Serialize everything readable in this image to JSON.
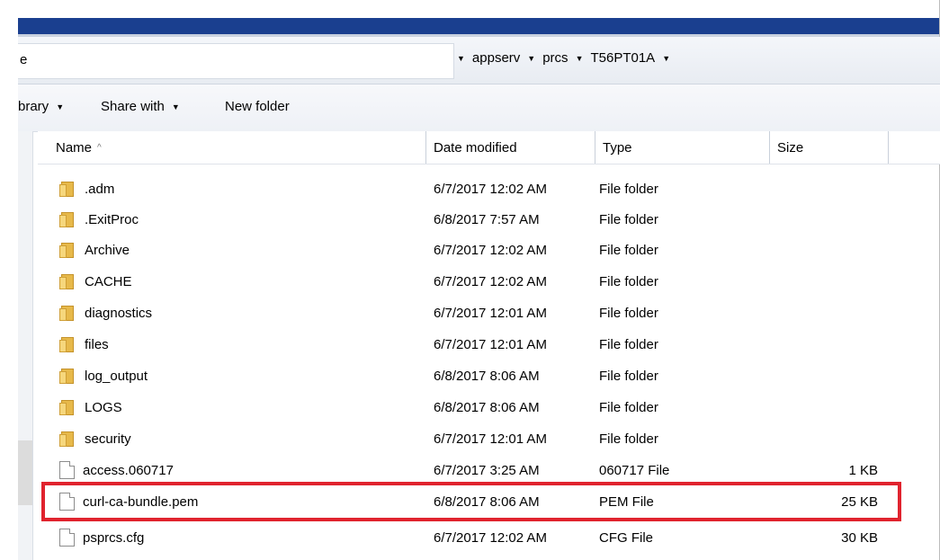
{
  "address": {
    "left_fragment": "e",
    "crumbs": [
      "appserv",
      "prcs",
      "T56PT01A"
    ]
  },
  "toolbar": {
    "library_label": "brary",
    "share_label": "Share with",
    "new_folder_label": "New folder"
  },
  "columns": {
    "name": "Name",
    "date": "Date modified",
    "type": "Type",
    "size": "Size"
  },
  "files": [
    {
      "name": ".adm",
      "date": "6/7/2017 12:02 AM",
      "type": "File folder",
      "size": "",
      "icon": "folder-icon"
    },
    {
      "name": ".ExitProc",
      "date": "6/8/2017 7:57 AM",
      "type": "File folder",
      "size": "",
      "icon": "folder-icon"
    },
    {
      "name": "Archive",
      "date": "6/7/2017 12:02 AM",
      "type": "File folder",
      "size": "",
      "icon": "folder-icon"
    },
    {
      "name": "CACHE",
      "date": "6/7/2017 12:02 AM",
      "type": "File folder",
      "size": "",
      "icon": "folder-icon"
    },
    {
      "name": "diagnostics",
      "date": "6/7/2017 12:01 AM",
      "type": "File folder",
      "size": "",
      "icon": "folder-icon"
    },
    {
      "name": "files",
      "date": "6/7/2017 12:01 AM",
      "type": "File folder",
      "size": "",
      "icon": "folder-icon"
    },
    {
      "name": "log_output",
      "date": "6/8/2017 8:06 AM",
      "type": "File folder",
      "size": "",
      "icon": "folder-icon"
    },
    {
      "name": "LOGS",
      "date": "6/8/2017 8:06 AM",
      "type": "File folder",
      "size": "",
      "icon": "folder-icon"
    },
    {
      "name": "security",
      "date": "6/7/2017 12:01 AM",
      "type": "File folder",
      "size": "",
      "icon": "folder-icon"
    },
    {
      "name": "access.060717",
      "date": "6/7/2017 3:25 AM",
      "type": "060717 File",
      "size": "1 KB",
      "icon": "file-icon"
    },
    {
      "name": "curl-ca-bundle.pem",
      "date": "6/8/2017 8:06 AM",
      "type": "PEM File",
      "size": "25 KB",
      "icon": "file-icon"
    },
    {
      "name": "psprcs.cfg",
      "date": "6/7/2017 12:02 AM",
      "type": "CFG File",
      "size": "30 KB",
      "icon": "file-icon"
    }
  ],
  "colors": {
    "title_band": "#1a3f8f",
    "highlight_box": "#e0232e"
  }
}
